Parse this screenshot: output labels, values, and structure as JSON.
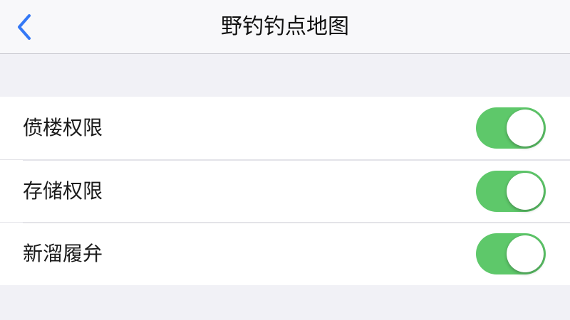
{
  "navbar": {
    "title": "野钓钓点地图",
    "back_icon": "chevron-left-icon"
  },
  "colors": {
    "accent": "#3478f6",
    "toggle_on": "#5ec86a",
    "background": "#f1f1f6"
  },
  "settings": [
    {
      "label": "偾楼权限",
      "enabled": true
    },
    {
      "label": "存储权限",
      "enabled": true
    },
    {
      "label": "新溜履弁",
      "enabled": true
    }
  ]
}
